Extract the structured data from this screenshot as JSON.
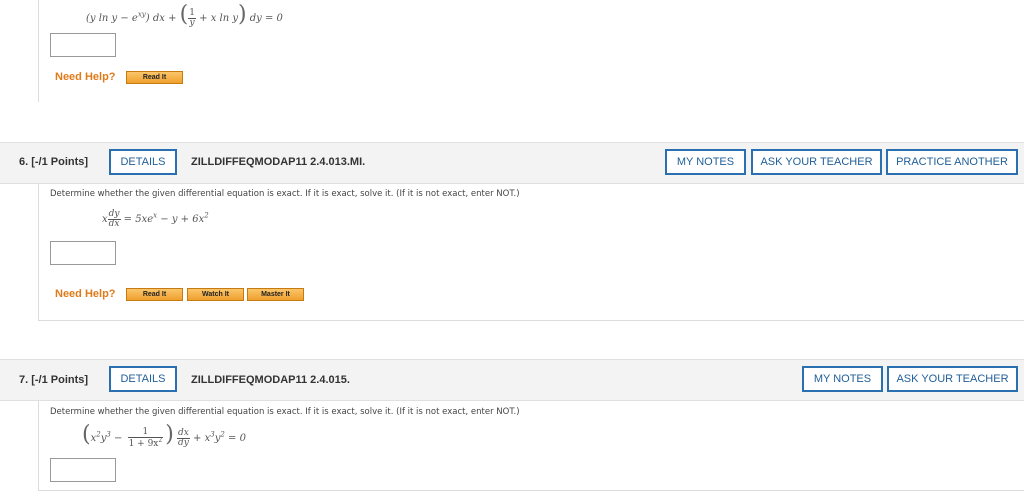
{
  "q5": {
    "need_help_label": "Need Help?",
    "help_buttons": [
      "Read It"
    ]
  },
  "q6": {
    "label": "6. [-/1 Points]",
    "details_label": "DETAILS",
    "code": "ZILLDIFFEQMODAP11 2.4.013.MI.",
    "right_buttons": [
      "MY NOTES",
      "ASK YOUR TEACHER",
      "PRACTICE ANOTHER"
    ],
    "prompt": "Determine whether the given differential equation is exact. If it is exact, solve it. (If it is not exact, enter NOT.)",
    "need_help_label": "Need Help?",
    "help_buttons": [
      "Read It",
      "Watch It",
      "Master It"
    ]
  },
  "q7": {
    "label": "7. [-/1 Points]",
    "details_label": "DETAILS",
    "code": "ZILLDIFFEQMODAP11 2.4.015.",
    "right_buttons": [
      "MY NOTES",
      "ASK YOUR TEACHER"
    ],
    "prompt": "Determine whether the given differential equation is exact. If it is exact, solve it. (If it is not exact, enter NOT.)"
  }
}
